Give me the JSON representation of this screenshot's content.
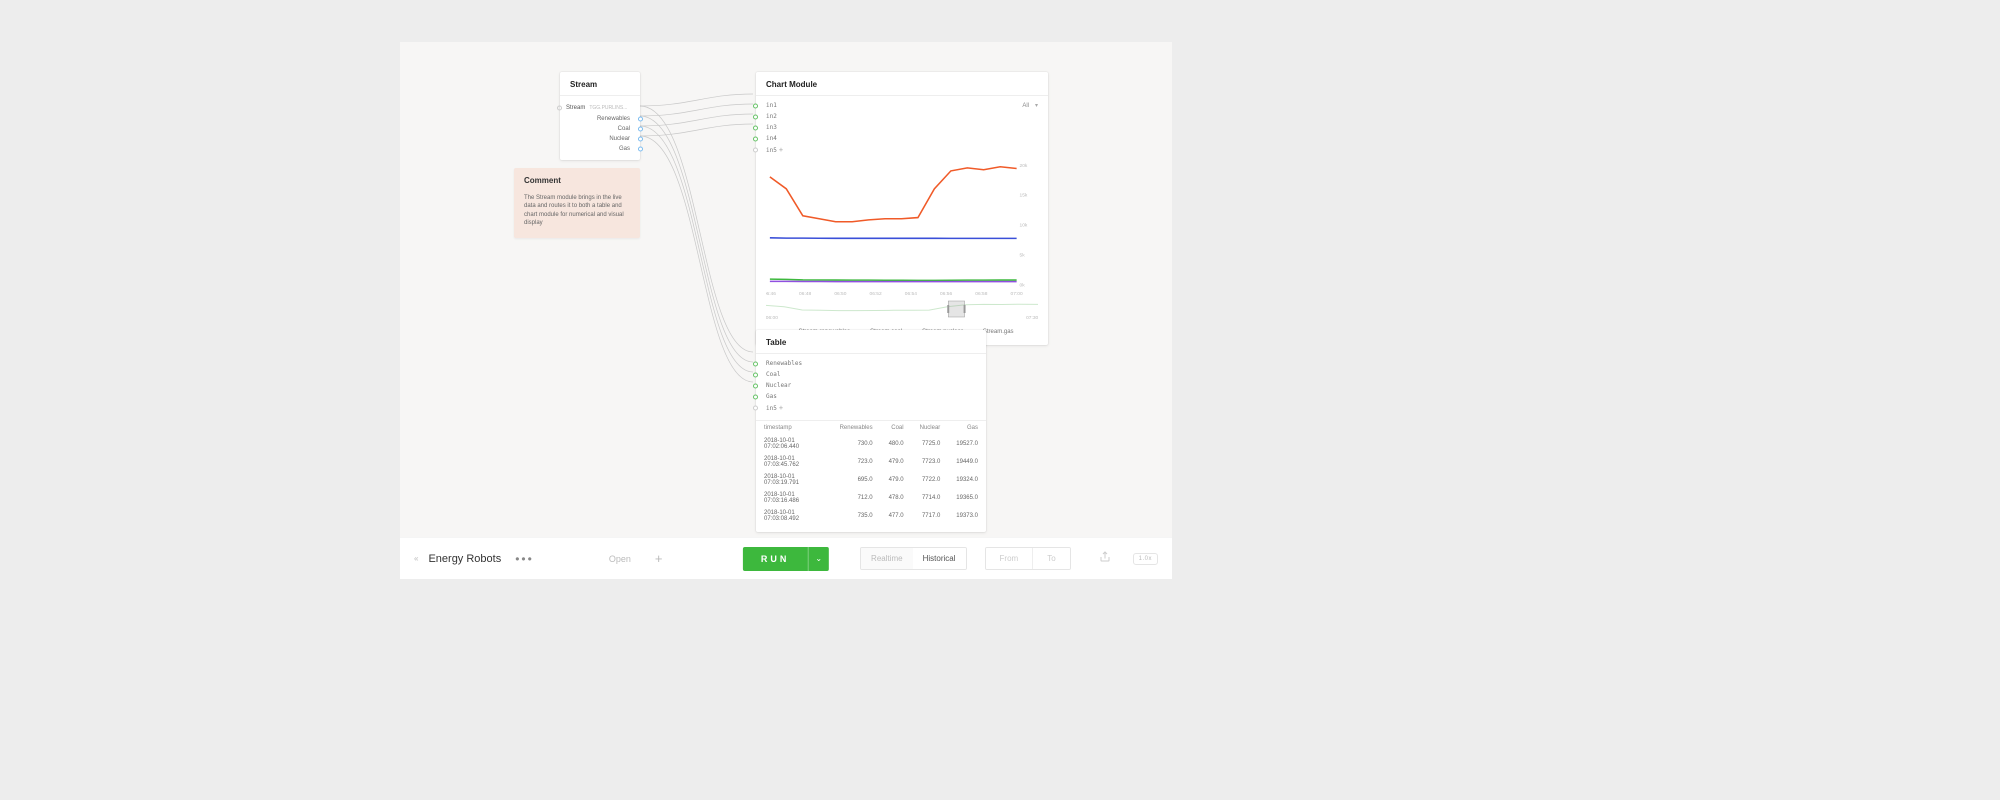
{
  "stream": {
    "title": "Stream",
    "main_label": "Stream",
    "main_sub": "TGG.PURLINS...",
    "outputs": [
      "Renewables",
      "Coal",
      "Nuclear",
      "Gas"
    ]
  },
  "comment": {
    "title": "Comment",
    "body": "The Stream module brings in the live data and routes it to both a table and chart module for numerical and visual display"
  },
  "chart": {
    "title": "Chart Module",
    "inputs": [
      "in1",
      "in2",
      "in3",
      "in4",
      "in5"
    ],
    "selector": "All",
    "legend": [
      {
        "label": "Stream.renewables",
        "color": "#3db83d"
      },
      {
        "label": "Stream.coal",
        "color": "#3a4fd8"
      },
      {
        "label": "Stream.nuclear",
        "color": "#904fe0"
      },
      {
        "label": "Stream.gas",
        "color": "#f05a28"
      }
    ]
  },
  "chart_data": {
    "type": "line",
    "x_ticks": [
      "06:46",
      "06:48",
      "06:50",
      "06:52",
      "06:54",
      "06:56",
      "06:58",
      "07:00"
    ],
    "y_ticks": [
      "0k",
      "5k",
      "10k",
      "15k",
      "20k"
    ],
    "ylim": [
      0,
      20000
    ],
    "series": [
      {
        "name": "Stream.gas",
        "color": "#f05a28",
        "values": [
          18000,
          16000,
          11500,
          11000,
          10500,
          10500,
          10800,
          11000,
          11000,
          11200,
          16000,
          19000,
          19500,
          19200,
          19700,
          19400
        ]
      },
      {
        "name": "Stream.nuclear",
        "color": "#3a4fd8",
        "values": [
          7800,
          7750,
          7750,
          7740,
          7730,
          7730,
          7725,
          7720,
          7720,
          7718,
          7718,
          7717,
          7717,
          7717,
          7717,
          7717
        ]
      },
      {
        "name": "Stream.renewables",
        "color": "#3db83d",
        "values": [
          900,
          850,
          780,
          760,
          740,
          730,
          720,
          715,
          710,
          700,
          700,
          710,
          720,
          730,
          735,
          735
        ]
      },
      {
        "name": "Stream.coal",
        "color": "#904fe0",
        "values": [
          520,
          510,
          500,
          495,
          490,
          485,
          482,
          480,
          480,
          479,
          479,
          478,
          478,
          477,
          477,
          477
        ]
      }
    ],
    "brush": {
      "start_label": "06:00",
      "end_label": "07:30",
      "window": [
        0.67,
        0.73
      ]
    }
  },
  "table": {
    "title": "Table",
    "inputs": [
      "Renewables",
      "Coal",
      "Nuclear",
      "Gas",
      "in5"
    ],
    "columns": [
      "timestamp",
      "Renewables",
      "Coal",
      "Nuclear",
      "Gas"
    ],
    "rows": [
      [
        "2018-10-01 07:02:06.440",
        "730.0",
        "480.0",
        "7725.0",
        "19527.0"
      ],
      [
        "2018-10-01 07:03:45.762",
        "723.0",
        "479.0",
        "7723.0",
        "19449.0"
      ],
      [
        "2018-10-01 07:03:19.791",
        "695.0",
        "479.0",
        "7722.0",
        "19324.0"
      ],
      [
        "2018-10-01 07:03:16.486",
        "712.0",
        "478.0",
        "7714.0",
        "19365.0"
      ],
      [
        "2018-10-01 07:03:08.492",
        "735.0",
        "477.0",
        "7717.0",
        "19373.0"
      ]
    ]
  },
  "toolbar": {
    "canvas_name": "Energy Robots",
    "open": "Open",
    "run": "RUN",
    "realtime": "Realtime",
    "historical": "Historical",
    "from": "From",
    "to": "To",
    "speed": "1.0x"
  }
}
